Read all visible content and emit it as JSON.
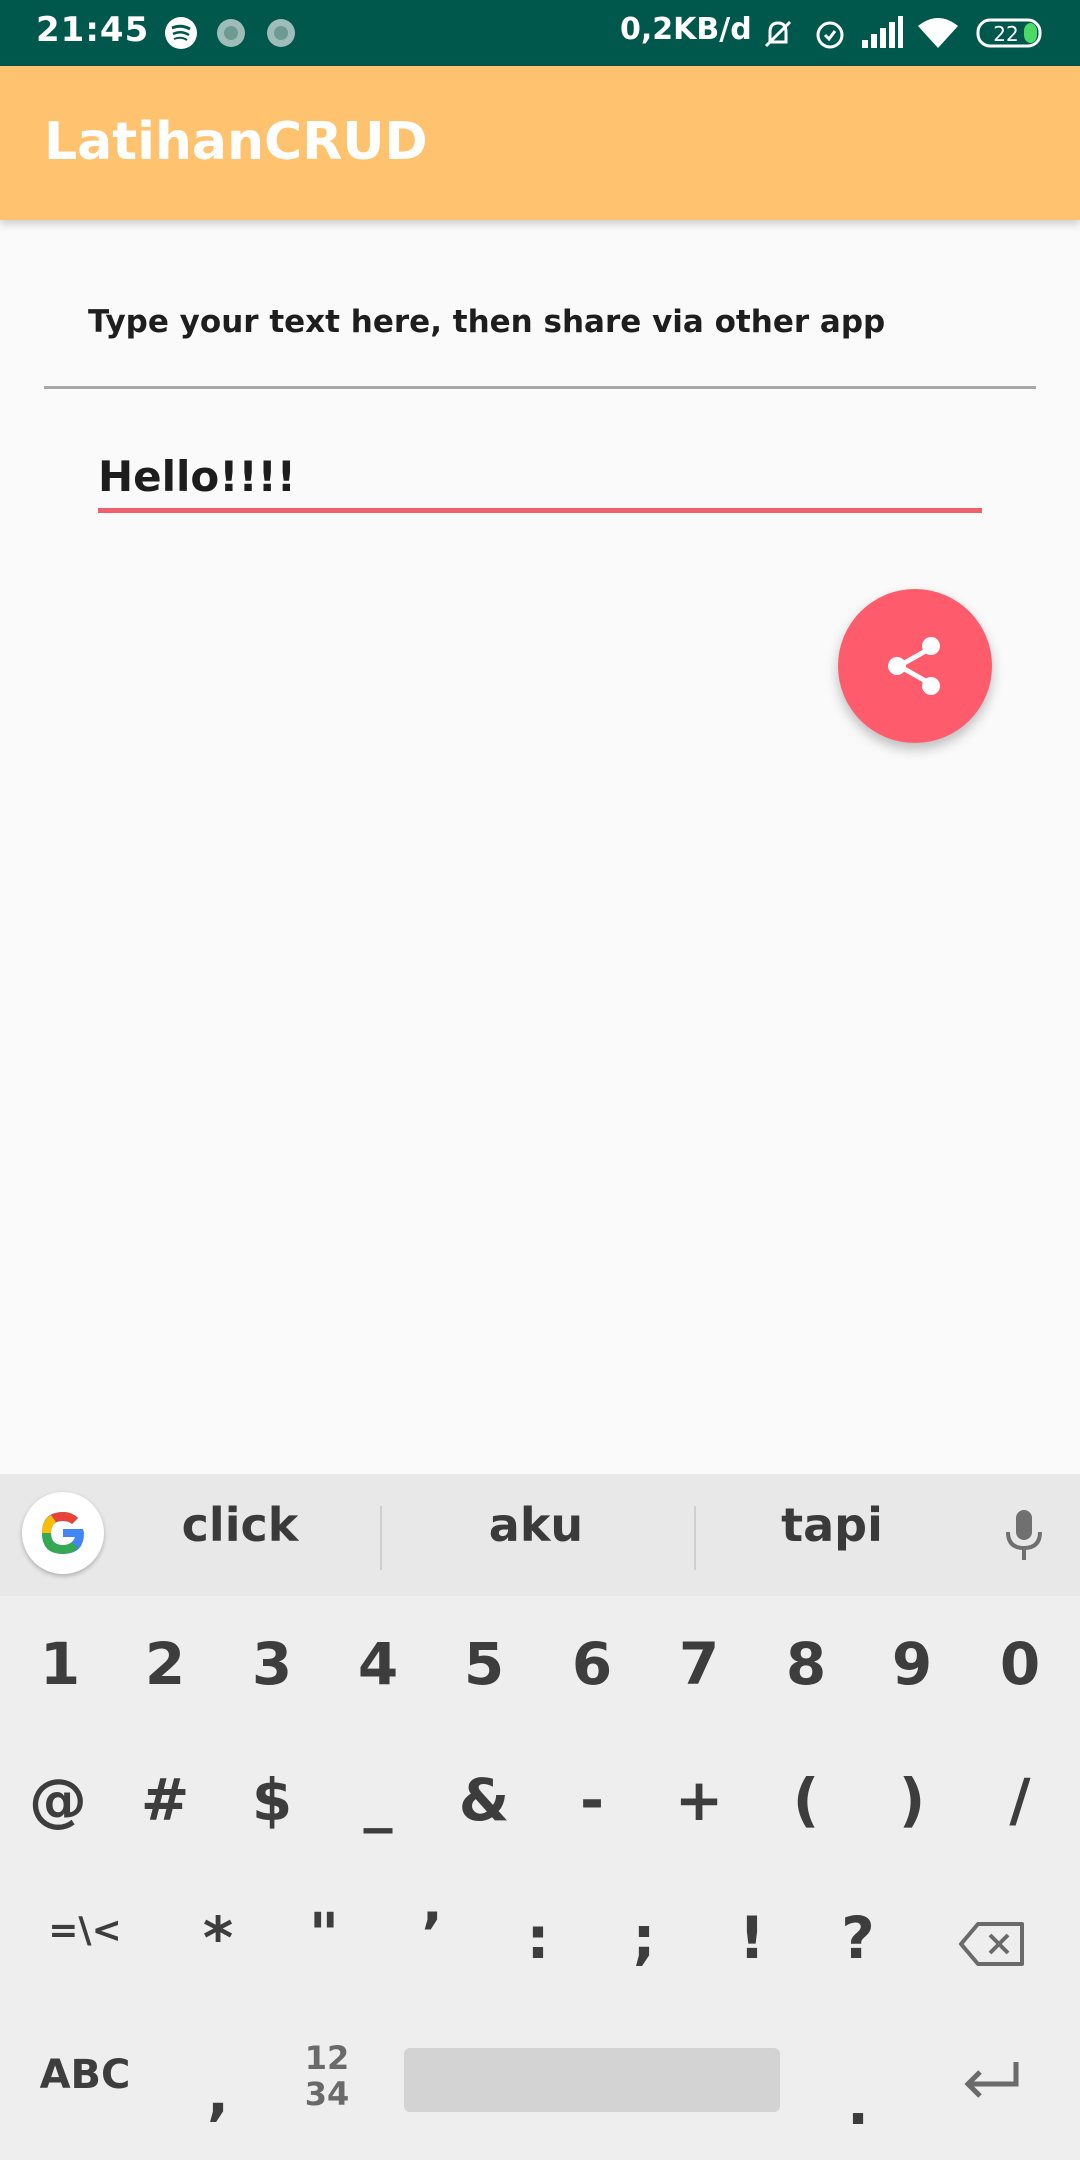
{
  "status_bar": {
    "time": "21:45",
    "net_speed": "0,2KB/d",
    "battery": "22",
    "icons": [
      "spotify-icon",
      "notification-icon",
      "notification-icon",
      "mute-icon",
      "alarm-icon",
      "signal-icon",
      "wifi-icon",
      "battery-icon"
    ]
  },
  "app_bar": {
    "title": "LatihanCRUD"
  },
  "content": {
    "prompt": "Type your text here, then share via other app",
    "input_value": "Hello!!!!"
  },
  "fab": {
    "icon": "share-icon",
    "color": "#fe5c6c"
  },
  "keyboard": {
    "suggestions": [
      "click",
      "aku",
      "tapi"
    ],
    "row_numbers": [
      "1",
      "2",
      "3",
      "4",
      "5",
      "6",
      "7",
      "8",
      "9",
      "0"
    ],
    "row_symbols1": [
      "@",
      "#",
      "$",
      "_",
      "&",
      "-",
      "+",
      "(",
      ")",
      "/"
    ],
    "row_symbols2": [
      "=\\<",
      "*",
      "\"",
      "’",
      ":",
      ";",
      "!",
      "?"
    ],
    "bottom": {
      "abc": "ABC",
      "comma": ",",
      "numpad_top": "12",
      "numpad_bottom": "34",
      "period": "."
    }
  },
  "colors": {
    "status_bar": "#00574b",
    "app_bar": "#ffc36f",
    "accent": "#f0616d"
  }
}
